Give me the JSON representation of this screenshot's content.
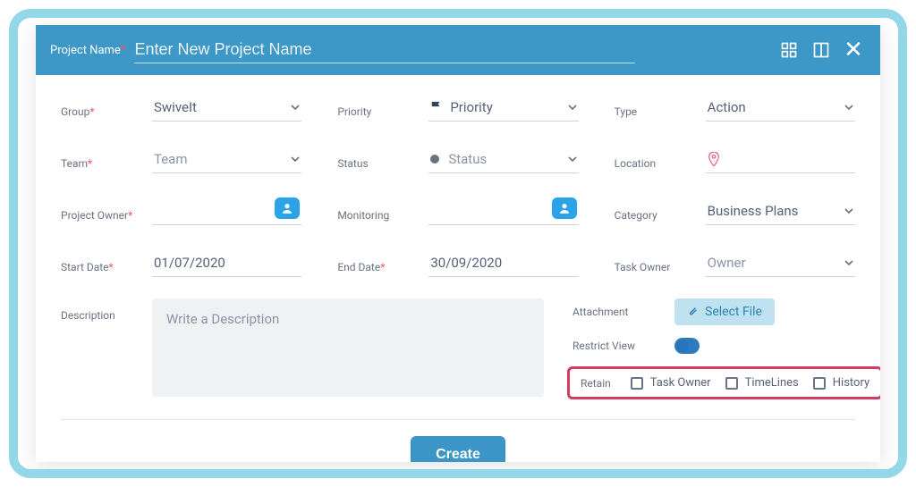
{
  "colors": {
    "accent": "#3d97c7",
    "required": "#ff4f57",
    "highlight_border": "#d33a62"
  },
  "header": {
    "label": "Project Name",
    "placeholder": "Enter New Project Name",
    "value": ""
  },
  "fields": {
    "group": {
      "label": "Group",
      "value": "SwiveIt",
      "required": true
    },
    "priority": {
      "label": "Priority",
      "value": "Priority"
    },
    "type": {
      "label": "Type",
      "value": "Action"
    },
    "team": {
      "label": "Team",
      "value": "Team",
      "required": true
    },
    "status": {
      "label": "Status",
      "value": "Status"
    },
    "location": {
      "label": "Location",
      "value": ""
    },
    "project_owner": {
      "label": "Project Owner",
      "value": "",
      "required": true
    },
    "monitoring": {
      "label": "Monitoring",
      "value": ""
    },
    "category": {
      "label": "Category",
      "value": "Business Plans"
    },
    "start_date": {
      "label": "Start Date",
      "value": "01/07/2020",
      "required": true
    },
    "end_date": {
      "label": "End Date",
      "value": "30/09/2020",
      "required": true
    },
    "task_owner": {
      "label": "Task Owner",
      "value": "Owner"
    },
    "description": {
      "label": "Description",
      "placeholder": "Write a Description"
    },
    "attachment": {
      "label": "Attachment",
      "button_label": "Select File"
    },
    "restrict": {
      "label": "Restrict View",
      "value": true
    },
    "retain": {
      "label": "Retain",
      "options": [
        {
          "label": "Task Owner",
          "checked": false
        },
        {
          "label": "TimeLines",
          "checked": false
        },
        {
          "label": "History",
          "checked": false
        }
      ]
    }
  },
  "actions": {
    "create": "Create"
  }
}
